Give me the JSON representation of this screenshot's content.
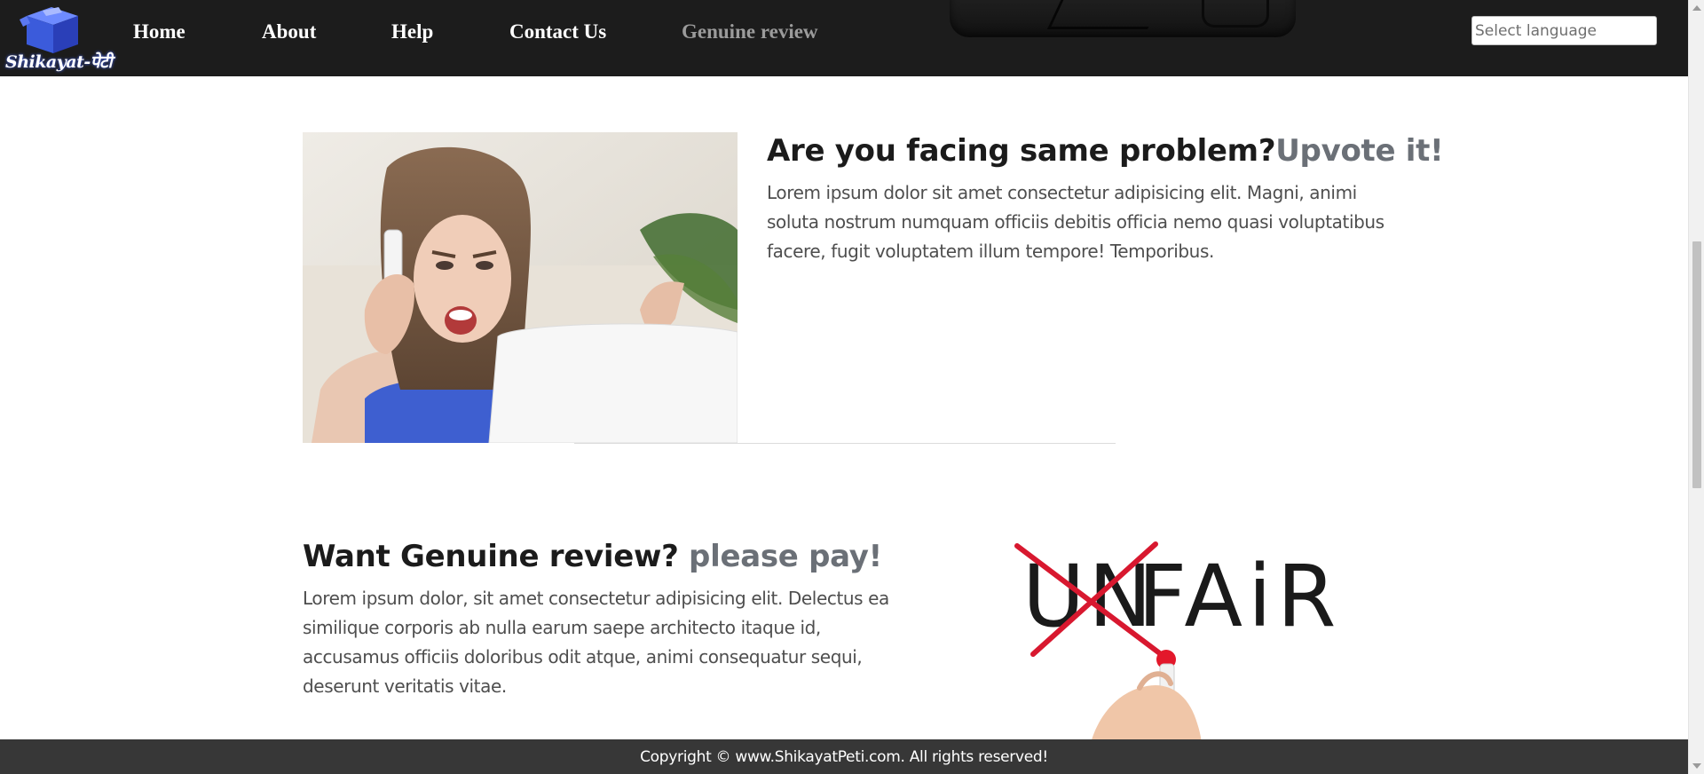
{
  "brand": {
    "logo_text": "Shikayat-पेटी",
    "accent_color": "#4a6bff"
  },
  "nav": {
    "items": [
      {
        "label": "Home"
      },
      {
        "label": "About"
      },
      {
        "label": "Help"
      },
      {
        "label": "Contact Us"
      },
      {
        "label": "Genuine review",
        "active": true
      }
    ]
  },
  "language_select": {
    "placeholder": "Select language"
  },
  "section1": {
    "title": "Are you facing same problem?",
    "title_accent": "Upvote it!",
    "text": "Lorem ipsum dolor sit amet consectetur adipisicing elit. Magni, animi soluta nostrum numquam officiis debitis officia nemo quasi voluptatibus facere, fugit voluptatem illum tempore! Temporibus.",
    "image": "frustrated-woman-on-phone-photo"
  },
  "section2": {
    "title": "Want Genuine review?",
    "title_accent": "please pay!",
    "text": "Lorem ipsum dolor, sit amet consectetur adipisicing elit. Delectus ea similique corporis ab nulla earum saepe architecto itaque id, accusamus officiis doloribus odit atque, animi consequatur sequi, deserunt veritatis vitae.",
    "image": "unfair-crossed-out-photo",
    "image_text_crossed": "UN",
    "image_text": "FAiR",
    "cross_color": "#d8182f"
  },
  "footer": {
    "text": "Copyright © www.ShikayatPeti.com. All rights reserved!"
  },
  "colors": {
    "navbar_bg": "#1c1c1c",
    "footer_bg": "#373737",
    "accent_text": "#6b7077",
    "active_nav": "#9b9b9b"
  }
}
